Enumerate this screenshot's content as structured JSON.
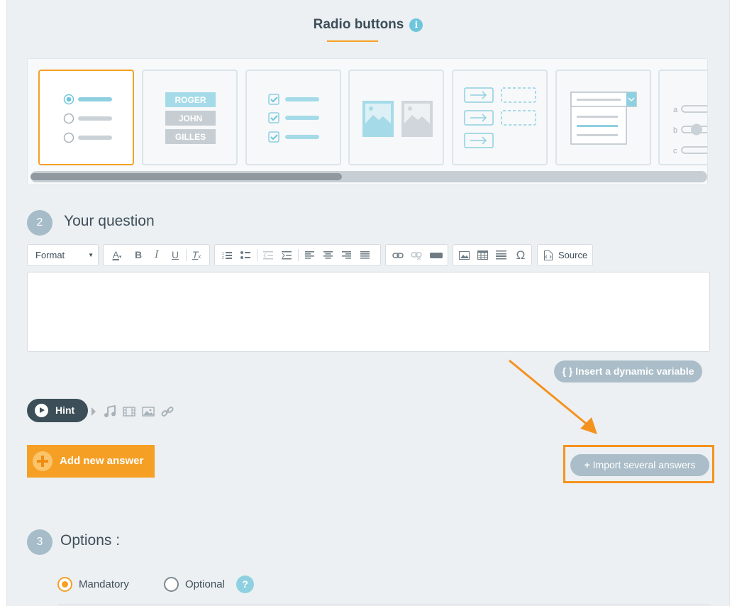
{
  "header": {
    "title": "Radio buttons",
    "info_icon": "info-icon"
  },
  "question_types": {
    "selected_index": 0,
    "cards": [
      {
        "name": "radio-buttons",
        "icon": "radio-list-icon"
      },
      {
        "name": "buttons-list",
        "icon": "button-list-icon",
        "labels": [
          "ROGER",
          "JOHN",
          "GILLES"
        ]
      },
      {
        "name": "checkboxes",
        "icon": "checkbox-list-icon"
      },
      {
        "name": "image-choice",
        "icon": "image-choice-icon"
      },
      {
        "name": "matching",
        "icon": "matching-icon"
      },
      {
        "name": "dropdown",
        "icon": "dropdown-list-icon"
      },
      {
        "name": "slider",
        "icon": "slider-icon",
        "labels": [
          "a",
          "b",
          "c"
        ]
      }
    ],
    "scroll_position": 0.46
  },
  "section2": {
    "number": "2",
    "label": "Your question",
    "toolbar": {
      "format_label": "Format",
      "source_label": "Source"
    },
    "editor_value": "",
    "dynamic_variable_label": "{ } Insert a dynamic variable"
  },
  "hint": {
    "label": "Hint"
  },
  "answers": {
    "add_label": "Add new answer",
    "import_label": "Import several answers"
  },
  "section3": {
    "number": "3",
    "label": "Options :",
    "mandatory_label": "Mandatory",
    "optional_label": "Optional",
    "selected": "Mandatory",
    "help_label": "?"
  },
  "colors": {
    "accent": "#f5a025",
    "panel_bg": "#ecf0f3",
    "step_badge": "#a6bcc8",
    "hint_bg": "#3c4f58",
    "annotation": "#f5921e"
  }
}
